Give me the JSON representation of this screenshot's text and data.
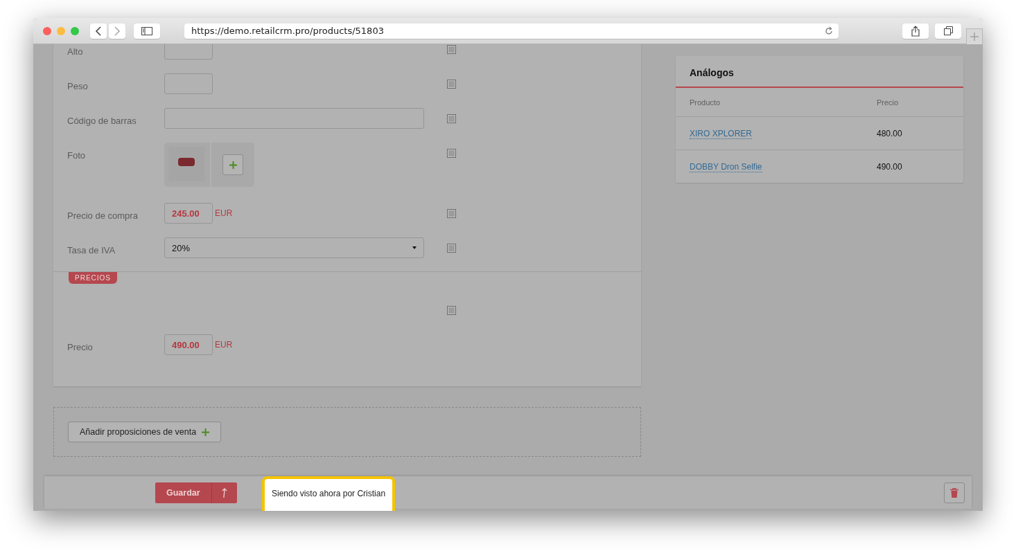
{
  "browser": {
    "url": "https://demo.retailcrm.pro/products/51803"
  },
  "form": {
    "rows": [
      {
        "kind": "short",
        "label": "Alto",
        "value": "",
        "checked": false
      },
      {
        "kind": "short",
        "label": "Peso",
        "value": "",
        "checked": false
      },
      {
        "kind": "wide",
        "label": "Código de barras",
        "value": "",
        "checked": false
      },
      {
        "kind": "photo",
        "label": "Foto",
        "checked": false
      },
      {
        "kind": "money",
        "label": "Precio de compra",
        "value": "245.00",
        "currency": "EUR",
        "checked": false
      },
      {
        "kind": "select",
        "label": "Tasa de IVA",
        "value": "20%",
        "checked": false
      }
    ],
    "prices_section": {
      "tag": "PRECIOS",
      "rows": [
        {
          "kind": "blank",
          "checked": false
        },
        {
          "kind": "money",
          "label": "Precio",
          "value": "490.00",
          "currency": "EUR"
        }
      ]
    }
  },
  "analogs": {
    "title": "Análogos",
    "columns": [
      "Producto",
      "Precio"
    ],
    "rows": [
      {
        "name": "XIRO XPLORER",
        "price": "480.00"
      },
      {
        "name": "DOBBY Dron Selfie",
        "price": "490.00"
      }
    ]
  },
  "add_offer_button": "Añadir proposiciones de venta",
  "save_button": "Guardar",
  "viewer_notice": "Siendo visto ahora por Cristian"
}
